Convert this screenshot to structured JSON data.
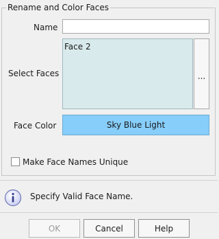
{
  "group": {
    "title": "Rename and Color Faces"
  },
  "name": {
    "label": "Name",
    "value": "",
    "placeholder": ""
  },
  "select_faces": {
    "label": "Select Faces",
    "items": [
      "Face 2"
    ],
    "browse_label": "..."
  },
  "face_color": {
    "label": "Face Color",
    "value": "Sky Blue Light",
    "color": "#87cefa"
  },
  "unique_names": {
    "label": "Make Face Names Unique",
    "checked": false
  },
  "status": {
    "icon": "info-icon",
    "message": "Specify Valid Face Name."
  },
  "buttons": {
    "ok": "OK",
    "cancel": "Cancel",
    "help": "Help"
  }
}
